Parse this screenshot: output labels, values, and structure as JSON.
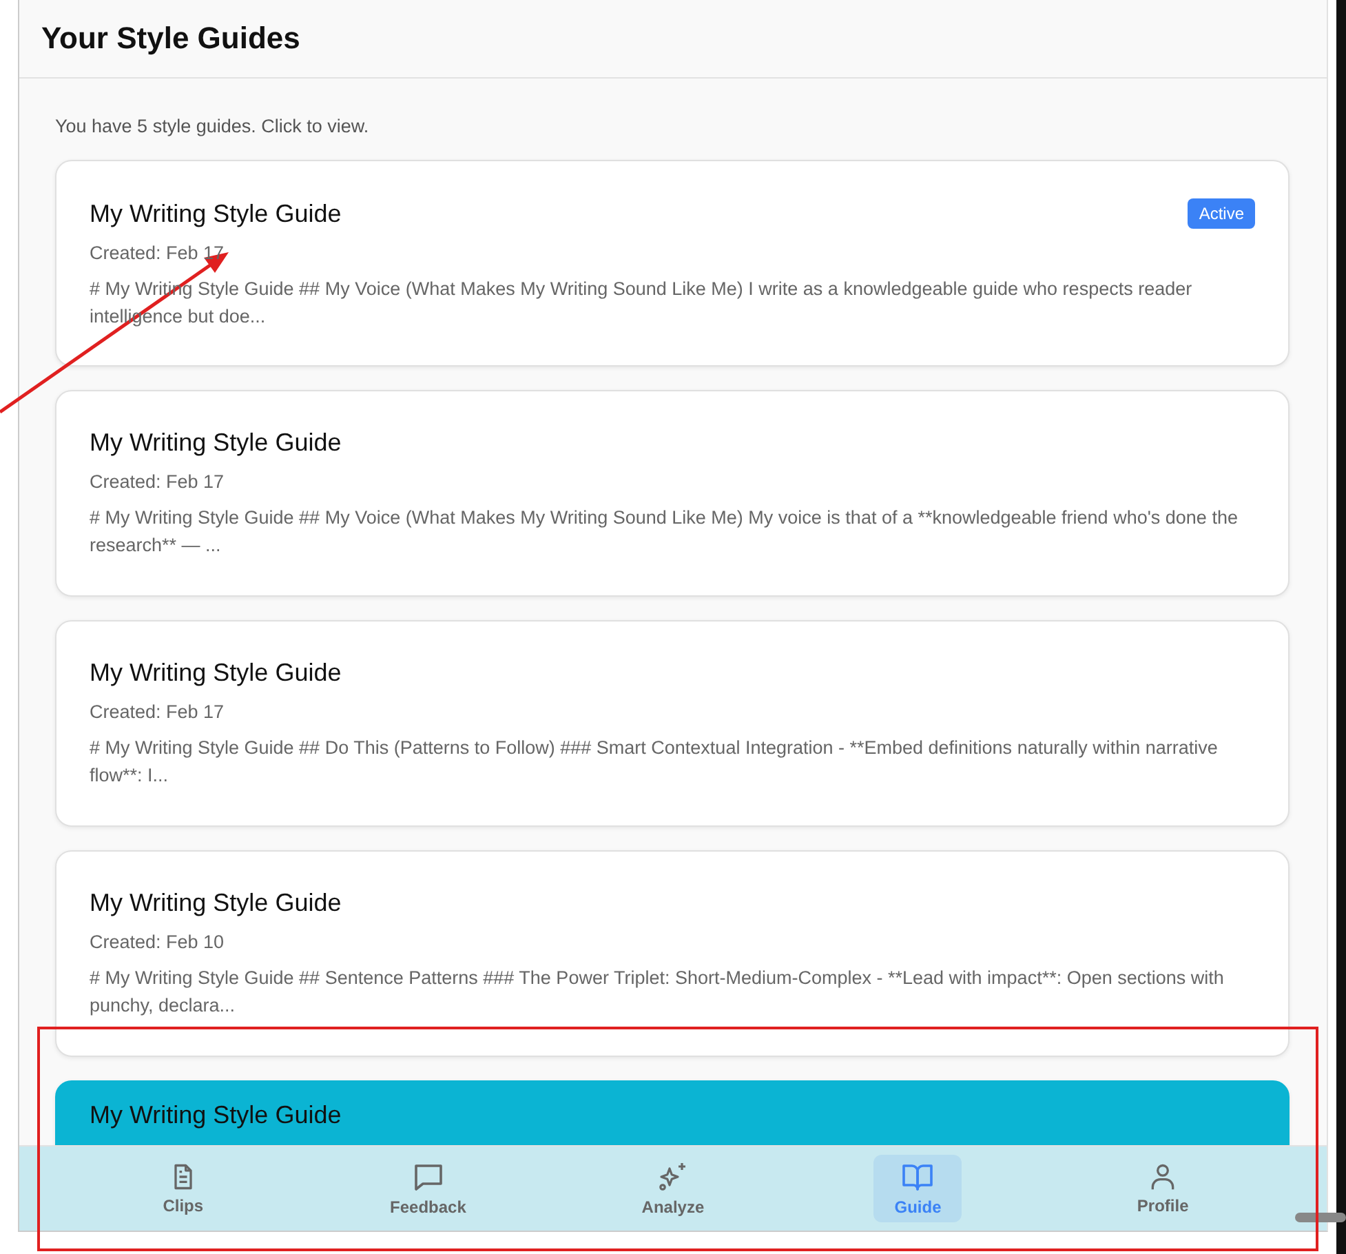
{
  "header": {
    "title": "Your Style Guides"
  },
  "summary": "You have 5 style guides. Click to view.",
  "guides": [
    {
      "title": "My Writing Style Guide",
      "selected": false,
      "badge": "Active",
      "created": "Created: Feb 17",
      "excerpt": "# My Writing Style Guide ## My Voice (What Makes My Writing Sound Like Me) I write as a knowledgeable guide who respects reader intelligence but doe..."
    },
    {
      "title": "My Writing Style Guide",
      "selected": false,
      "created": "Created: Feb 17",
      "excerpt": "# My Writing Style Guide ## My Voice (What Makes My Writing Sound Like Me) My voice is that of a **knowledgeable friend who's done the research** — ..."
    },
    {
      "title": "My Writing Style Guide",
      "selected": false,
      "created": "Created: Feb 17",
      "excerpt": "# My Writing Style Guide ## Do This (Patterns to Follow) ### Smart Contextual Integration - **Embed definitions naturally within narrative flow**: I..."
    },
    {
      "title": "My Writing Style Guide",
      "selected": false,
      "created": "Created: Feb 10",
      "excerpt": "# My Writing Style Guide ## Sentence Patterns ### The Power Triplet: Short-Medium-Complex - **Lead with impact**: Open sections with punchy, declara..."
    },
    {
      "title": "My Writing Style Guide",
      "selected": true
    }
  ],
  "bottom_nav": [
    {
      "label": "Clips",
      "selected": false
    },
    {
      "label": "Feedback",
      "selected": false
    },
    {
      "label": "Analyze",
      "selected": false
    },
    {
      "label": "Guide",
      "selected": true
    },
    {
      "label": "Profile",
      "selected": false
    }
  ]
}
